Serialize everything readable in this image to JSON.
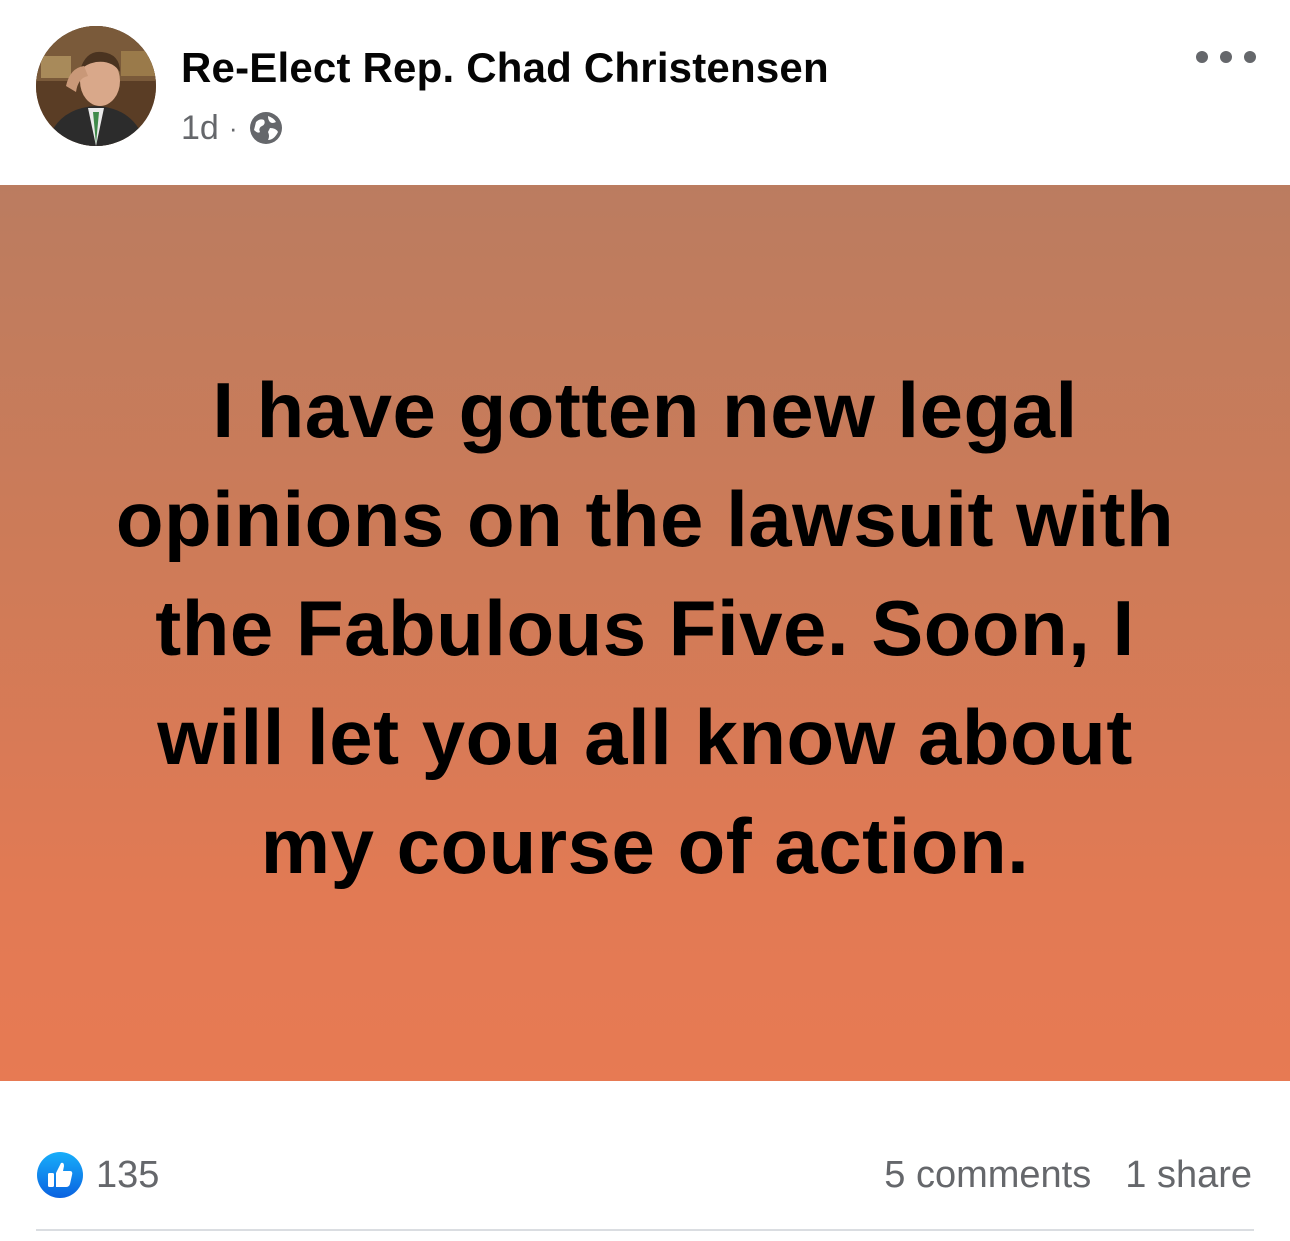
{
  "post": {
    "author": "Re-Elect Rep. Chad Christensen",
    "time": "1d",
    "separator": "·",
    "audience_icon": "globe-icon",
    "more_icon": "more-horizontal-icon",
    "text": "I have gotten new legal opinions on the lawsuit with the Fabulous Five. Soon, I will let you all know about my course of action.",
    "background_colors": [
      "#bb7c60",
      "#e77a53"
    ]
  },
  "footer": {
    "like_icon": "like-icon",
    "like_count": "135",
    "comments": "5 comments",
    "shares": "1 share"
  },
  "colors": {
    "accent_blue": "#1877f2",
    "secondary_text": "#65676b"
  }
}
